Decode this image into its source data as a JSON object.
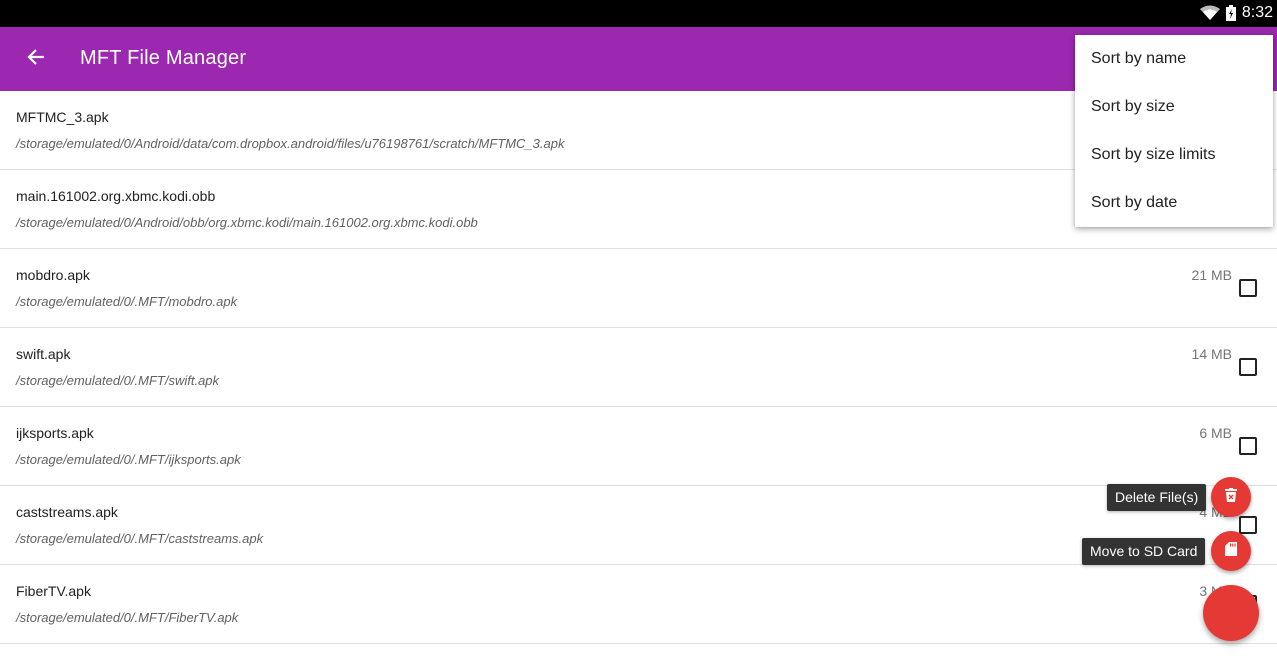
{
  "status_bar": {
    "time": "8:32"
  },
  "app_bar": {
    "title": "MFT File Manager"
  },
  "files": [
    {
      "name": "MFTMC_3.apk",
      "path": "/storage/emulated/0/Android/data/com.dropbox.android/files/u76198761/scratch/MFTMC_3.apk",
      "size": ""
    },
    {
      "name": "main.161002.org.xbmc.kodi.obb",
      "path": "/storage/emulated/0/Android/obb/org.xbmc.kodi/main.161002.org.xbmc.kodi.obb",
      "size": ""
    },
    {
      "name": "mobdro.apk",
      "path": "/storage/emulated/0/.MFT/mobdro.apk",
      "size": "21 MB"
    },
    {
      "name": "swift.apk",
      "path": "/storage/emulated/0/.MFT/swift.apk",
      "size": "14 MB"
    },
    {
      "name": "ijksports.apk",
      "path": "/storage/emulated/0/.MFT/ijksports.apk",
      "size": "6 MB"
    },
    {
      "name": "caststreams.apk",
      "path": "/storage/emulated/0/.MFT/caststreams.apk",
      "size": "4 MB"
    },
    {
      "name": "FiberTV.apk",
      "path": "/storage/emulated/0/.MFT/FiberTV.apk",
      "size": "3 MB"
    }
  ],
  "menu": {
    "items": [
      "Sort by name",
      "Sort by size",
      "Sort by size limits",
      "Sort by date"
    ]
  },
  "fab": {
    "delete_label": "Delete File(s)",
    "move_label": "Move to SD Card"
  },
  "colors": {
    "app_bar": "#9c27b0",
    "fab": "#e53935"
  }
}
